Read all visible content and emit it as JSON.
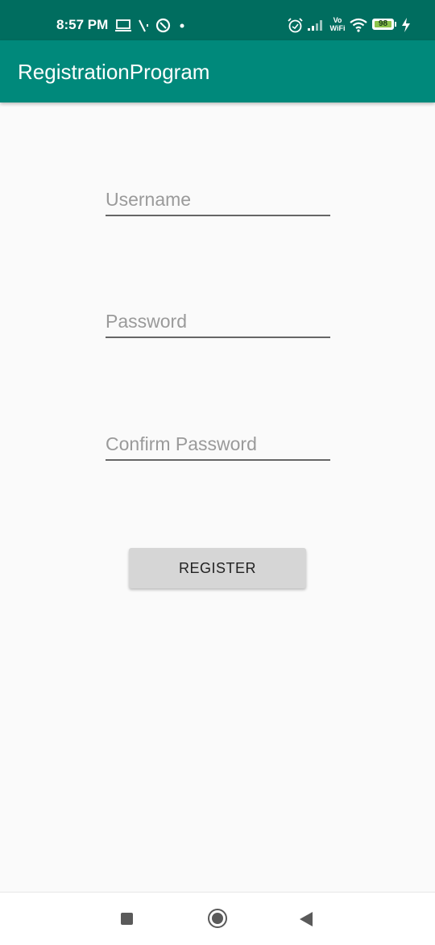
{
  "status_bar": {
    "time": "8:57 PM",
    "left_icons": [
      "laptop-icon",
      "signal-slash-icon",
      "data-saver-icon",
      "dot-icon"
    ],
    "right_icons": [
      "alarm-icon",
      "cell-signal-icon",
      "vowifi-icon",
      "wifi-icon",
      "battery-icon",
      "charging-icon"
    ],
    "vowifi_label_top": "Vo",
    "vowifi_label_bottom": "WiFi",
    "battery_level": "98",
    "background_color": "#006d5f"
  },
  "app_bar": {
    "title": "RegistrationProgram",
    "background_color": "#00897b"
  },
  "form": {
    "username": {
      "placeholder": "Username",
      "value": ""
    },
    "password": {
      "placeholder": "Password",
      "value": ""
    },
    "confirm_password": {
      "placeholder": "Confirm Password",
      "value": ""
    },
    "register_label": "REGISTER"
  },
  "nav_bar": {
    "items": [
      "recents-icon",
      "home-icon",
      "back-icon"
    ]
  }
}
